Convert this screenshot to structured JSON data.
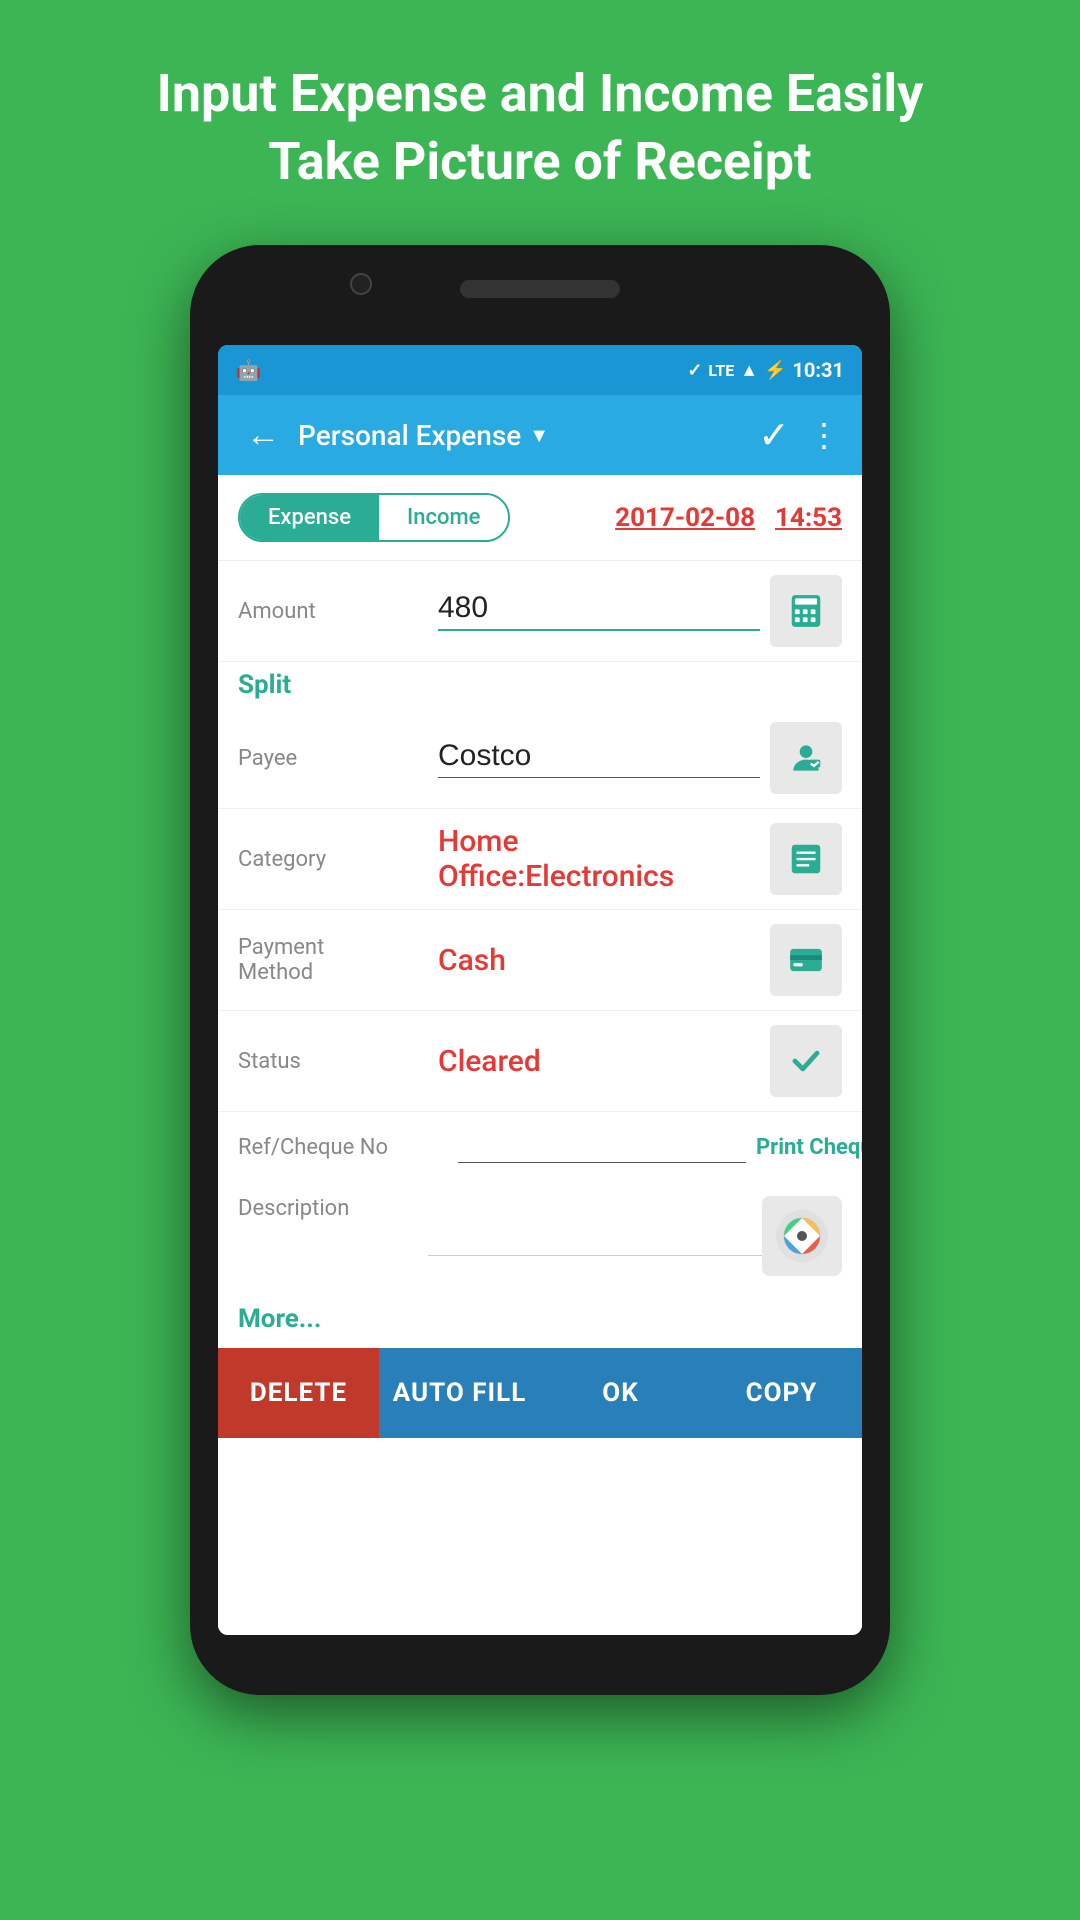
{
  "promo": {
    "line1": "Input Expense and Income Easily",
    "line2": "Take Picture of Receipt"
  },
  "statusBar": {
    "time": "10:31",
    "icons": [
      "bluetooth",
      "lte",
      "signal",
      "battery"
    ]
  },
  "toolbar": {
    "title": "Personal Expense",
    "backArrow": "←",
    "dropdownArrow": "▼",
    "checkmark": "✓",
    "moreIcon": "⋮"
  },
  "tabs": {
    "expense": "Expense",
    "income": "Income"
  },
  "dateTime": {
    "date": "2017-02-08",
    "time": "14:53"
  },
  "form": {
    "amountLabel": "Amount",
    "amountValue": "480",
    "splitLabel": "Split",
    "payeeLabel": "Payee",
    "payeeValue": "Costco",
    "categoryLabel": "Category",
    "categoryValue": "Home Office:Electronics",
    "paymentMethodLabel": "Payment\nMethod",
    "paymentMethodValue": "Cash",
    "statusLabel": "Status",
    "statusValue": "Cleared",
    "refLabel": "Ref/Cheque No",
    "refValue": "",
    "printCheque": "Print Cheque",
    "descriptionLabel": "Description",
    "descriptionValue": "",
    "moreLinkLabel": "More..."
  },
  "actionBar": {
    "delete": "DELETE",
    "autofill": "AUTO FILL",
    "ok": "OK",
    "copy": "COPY"
  }
}
